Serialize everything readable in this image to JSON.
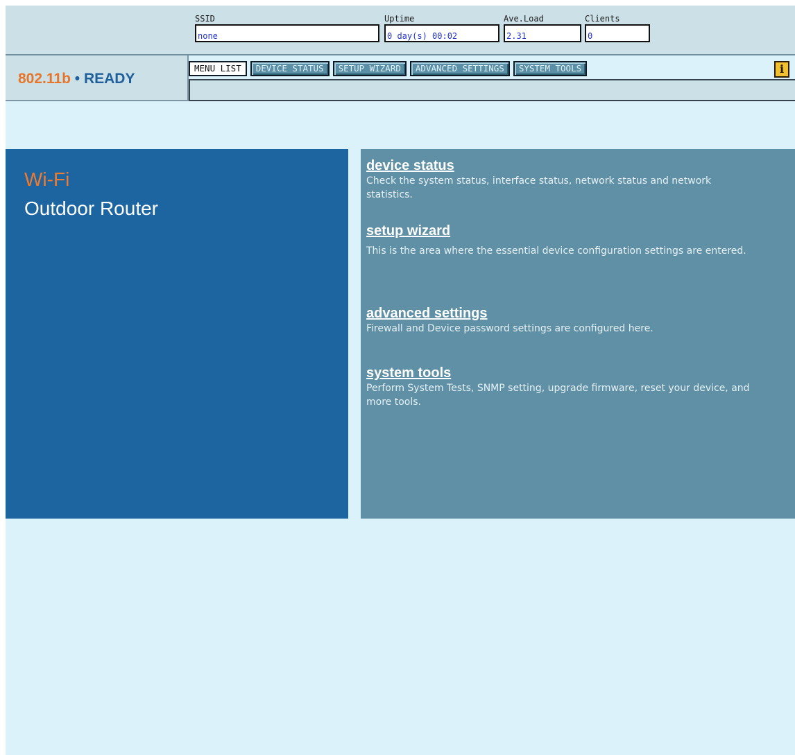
{
  "stats": {
    "ssid": {
      "label": "SSID",
      "value": "none"
    },
    "uptime": {
      "label": "Uptime",
      "value": "0 day(s) 00:02"
    },
    "ave_load": {
      "label": "Ave.Load",
      "value": "2.31"
    },
    "clients": {
      "label": "Clients",
      "value": "0"
    }
  },
  "status": {
    "standard": "802.11b",
    "separator": "•",
    "state": "READY"
  },
  "menu": {
    "items": [
      {
        "label": "MENU LIST",
        "active": true
      },
      {
        "label": "DEVICE STATUS",
        "active": false
      },
      {
        "label": "SETUP WIZARD",
        "active": false
      },
      {
        "label": "ADVANCED SETTINGS",
        "active": false
      },
      {
        "label": "SYSTEM TOOLS",
        "active": false
      }
    ],
    "info_icon": "info-icon",
    "info_glyph": "i"
  },
  "brand": {
    "line1": "Wi-Fi",
    "line2": "Outdoor Router"
  },
  "sections": [
    {
      "title": "device status",
      "description": "Check the system status, interface status, network status and network statistics."
    },
    {
      "title": "setup wizard",
      "description": "This is the area where the essential device configuration settings are entered."
    },
    {
      "title": "advanced settings",
      "description": "Firewall and Device password settings are configured here."
    },
    {
      "title": "system tools",
      "description": "Perform System Tests, SNMP setting, upgrade firmware, reset your device, and more tools."
    }
  ],
  "colors": {
    "brand_orange": "#e8762a",
    "brand_blue": "#1d65a1",
    "panel_teal": "#5f90a6",
    "page_background": "#dcf2fb"
  }
}
